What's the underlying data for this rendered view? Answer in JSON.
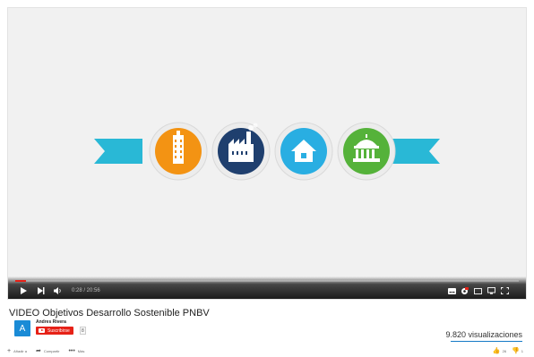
{
  "player": {
    "time_display": "0:28 / 20:56",
    "progress_fraction": 0.022,
    "icons": {
      "play": "play-icon",
      "next": "next-icon",
      "volume": "volume-icon",
      "subtitles": "subtitles-icon",
      "settings": "settings-icon",
      "miniplayer": "miniplayer-icon",
      "cast": "cast-icon",
      "fullscreen": "fullscreen-icon"
    },
    "colors": {
      "progress": "#e62117",
      "ribbon": "#29b8d6",
      "orange_circle": "#f39313",
      "navy_circle": "#1f3f6e",
      "blue_circle": "#29aee2",
      "green_circle": "#55b23a"
    },
    "badges": [
      "building-icon",
      "factory-icon",
      "house-icon",
      "government-icon"
    ]
  },
  "video": {
    "title": "VIDEO Objetivos Desarrollo Sostenible PNBV",
    "channel_name": "Andres Rivera",
    "avatar_letter": "A",
    "subscribe_label": "Suscribirse",
    "subscriber_count": "8",
    "views": "9.820 visualizaciones"
  },
  "actions": {
    "add_label": "Añadir a",
    "share_label": "Compartir",
    "more_label": "Más",
    "likes": "26",
    "dislikes": "1"
  }
}
